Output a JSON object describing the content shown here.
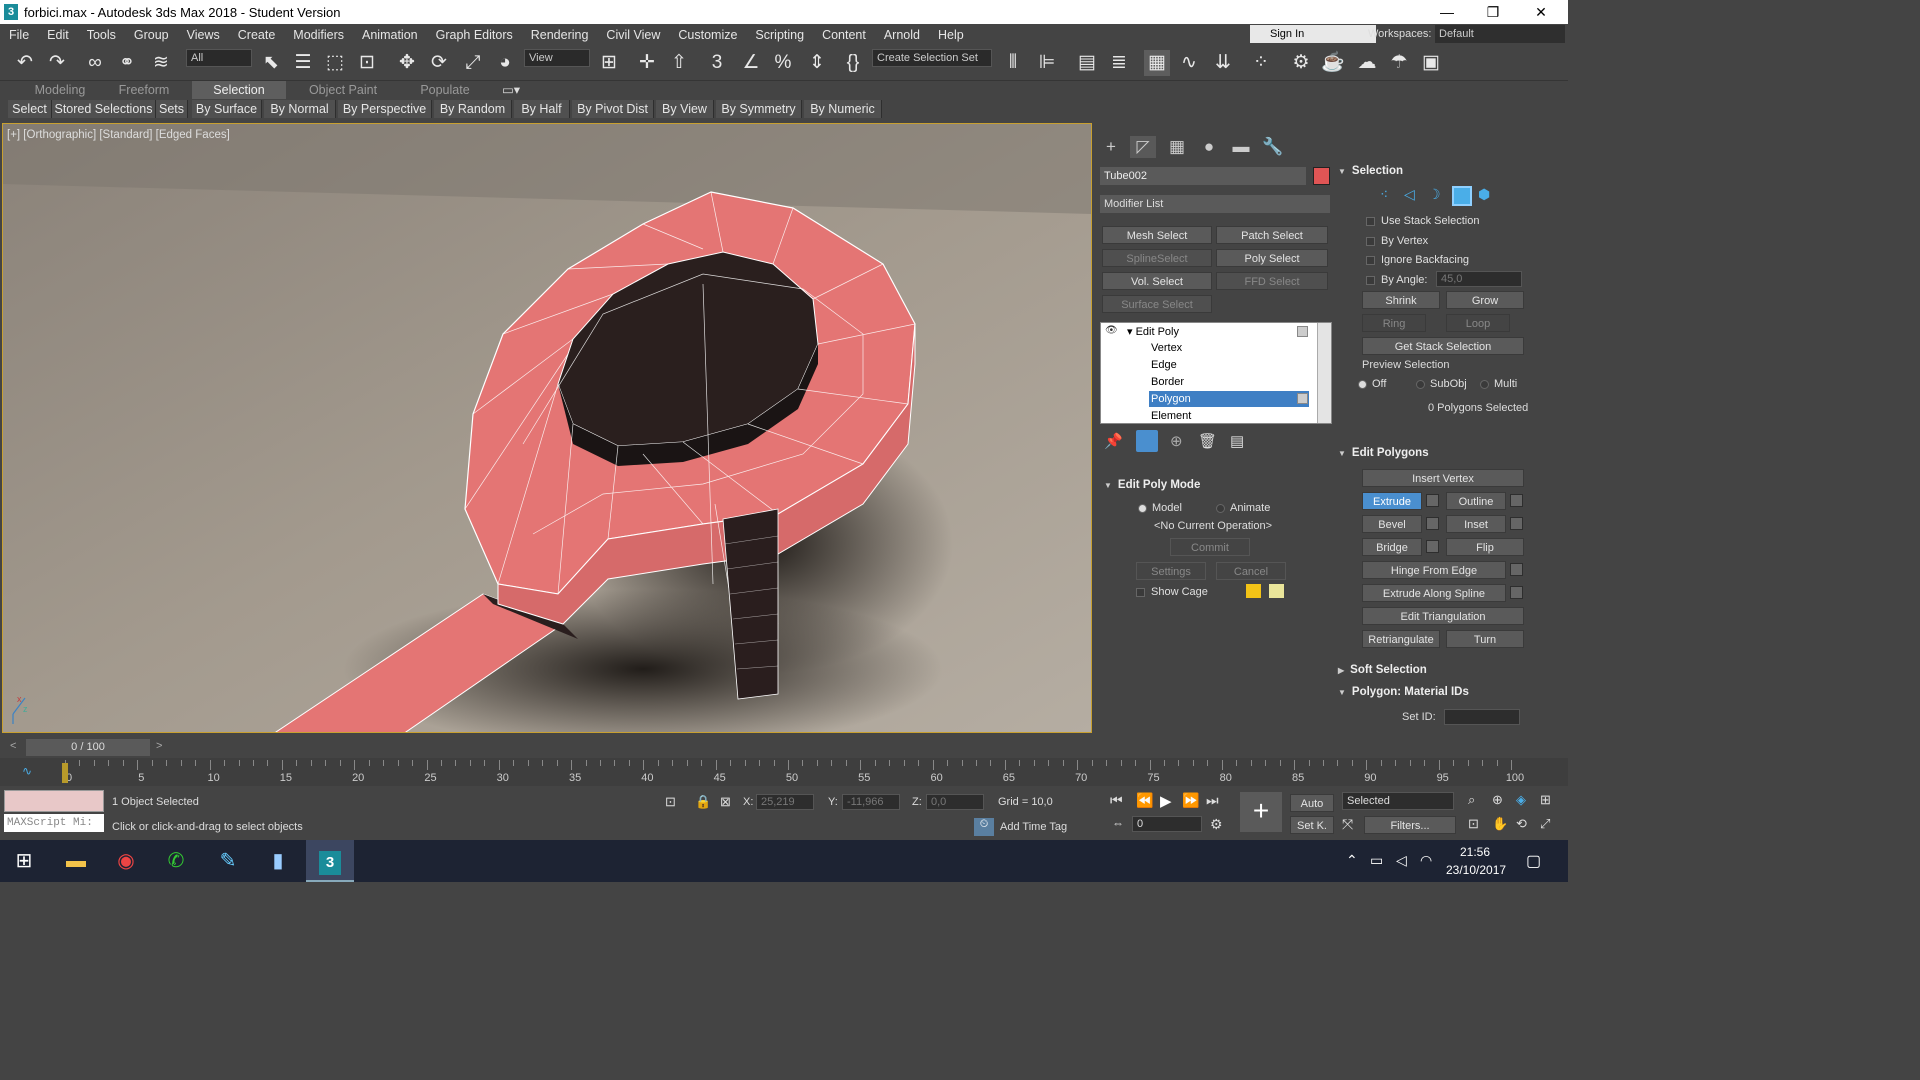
{
  "window": {
    "title": "forbici.max - Autodesk 3ds Max 2018 - Student Version",
    "icon": "3",
    "minimize": "—",
    "restore": "❐",
    "close": "✕"
  },
  "menu": [
    "File",
    "Edit",
    "Tools",
    "Group",
    "Views",
    "Create",
    "Modifiers",
    "Animation",
    "Graph Editors",
    "Rendering",
    "Civil View",
    "Customize",
    "Scripting",
    "Content",
    "Arnold",
    "Help"
  ],
  "account": {
    "signin": "Sign In",
    "workspaces_label": "Workspaces:",
    "workspace": "Default"
  },
  "toolbar": {
    "filter": "All",
    "refcoord": "View",
    "selset": "Create Selection Set"
  },
  "ribbon_tabs": [
    "Modeling",
    "Freeform",
    "Selection",
    "Object Paint",
    "Populate"
  ],
  "ribbon_items": [
    "Select",
    "Stored Selections",
    "Sets",
    "By Surface",
    "By Normal",
    "By Perspective",
    "By Random",
    "By Half",
    "By Pivot Dist",
    "By View",
    "By Symmetry",
    "By Numeric"
  ],
  "viewport": {
    "label": "[+] [Orthographic] [Standard] [Edged Faces]"
  },
  "panel": {
    "object_name": "Tube002",
    "object_color": "#e05555",
    "modifier_list": "Modifier List",
    "mod_buttons": [
      "Mesh Select",
      "Patch Select",
      "SplineSelect",
      "Poly Select",
      "Vol. Select",
      "FFD Select",
      "Surface Select"
    ],
    "stack": [
      "Edit Poly",
      "Vertex",
      "Edge",
      "Border",
      "Polygon",
      "Element"
    ],
    "edit_poly_mode": {
      "title": "Edit Poly Mode",
      "model": "Model",
      "animate": "Animate",
      "operation": "<No Current Operation>",
      "commit": "Commit",
      "settings": "Settings",
      "cancel": "Cancel",
      "show_cage": "Show Cage"
    },
    "selection": {
      "title": "Selection",
      "use_stack": "Use Stack Selection",
      "by_vertex": "By Vertex",
      "ignore_backfacing": "Ignore Backfacing",
      "by_angle": "By Angle:",
      "angle": "45,0",
      "shrink": "Shrink",
      "grow": "Grow",
      "ring": "Ring",
      "loop": "Loop",
      "get_stack": "Get Stack Selection",
      "preview": "Preview Selection",
      "off": "Off",
      "subobj": "SubObj",
      "multi": "Multi",
      "status": "0 Polygons Selected"
    },
    "edit_polygons": {
      "title": "Edit Polygons",
      "insert_vertex": "Insert Vertex",
      "extrude": "Extrude",
      "outline": "Outline",
      "bevel": "Bevel",
      "inset": "Inset",
      "bridge": "Bridge",
      "flip": "Flip",
      "hinge": "Hinge From Edge",
      "extrude_spline": "Extrude Along Spline",
      "edit_tri": "Edit Triangulation",
      "retriangulate": "Retriangulate",
      "turn": "Turn"
    },
    "soft_selection": "Soft Selection",
    "material_ids": {
      "title": "Polygon: Material IDs",
      "set_id": "Set ID:"
    }
  },
  "timeline": {
    "frame": "0 / 100",
    "ticks": [
      "0",
      "5",
      "10",
      "15",
      "20",
      "25",
      "30",
      "35",
      "40",
      "45",
      "50",
      "55",
      "60",
      "65",
      "70",
      "75",
      "80",
      "85",
      "90",
      "95",
      "100"
    ]
  },
  "status": {
    "maxscript": "MAXScript Mi:",
    "objects": "1 Object Selected",
    "hint": "Click or click-and-drag to select objects",
    "x_label": "X:",
    "x": "25,219",
    "y_label": "Y:",
    "y": "-11,966",
    "z_label": "Z:",
    "z": "0,0",
    "grid": "Grid = 10,0",
    "add_time_tag": "Add Time Tag",
    "auto": "Auto",
    "setk": "Set K.",
    "selected": "Selected",
    "filters": "Filters...",
    "frame_field": "0"
  },
  "taskbar": {
    "time": "21:56",
    "date": "23/10/2017"
  }
}
